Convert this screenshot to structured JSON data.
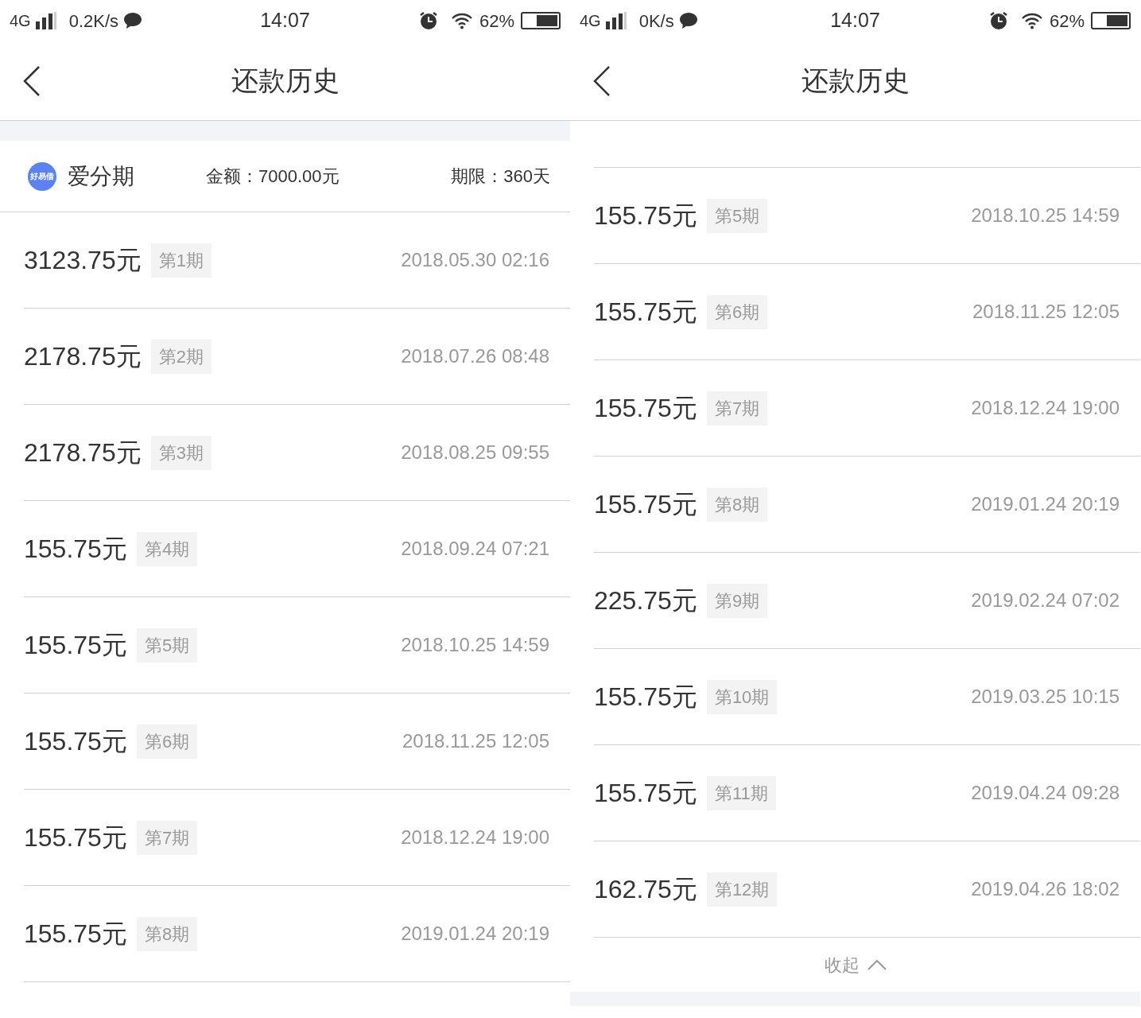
{
  "screens": [
    {
      "status_bar": {
        "network": "4G",
        "speed": "0.2K/s",
        "time": "14:07",
        "battery": "62%"
      },
      "title": "还款历史",
      "summary": {
        "logo_text": "好易借",
        "name": "爱分期",
        "amount": "金额：7000.00元",
        "term": "期限：360天"
      },
      "records": [
        {
          "amount": "3123.75元",
          "period": "第1期",
          "date": "2018.05.30 02:16"
        },
        {
          "amount": "2178.75元",
          "period": "第2期",
          "date": "2018.07.26 08:48"
        },
        {
          "amount": "2178.75元",
          "period": "第3期",
          "date": "2018.08.25 09:55"
        },
        {
          "amount": "155.75元",
          "period": "第4期",
          "date": "2018.09.24 07:21"
        },
        {
          "amount": "155.75元",
          "period": "第5期",
          "date": "2018.10.25 14:59"
        },
        {
          "amount": "155.75元",
          "period": "第6期",
          "date": "2018.11.25 12:05"
        },
        {
          "amount": "155.75元",
          "period": "第7期",
          "date": "2018.12.24 19:00"
        },
        {
          "amount": "155.75元",
          "period": "第8期",
          "date": "2019.01.24 20:19"
        }
      ]
    },
    {
      "status_bar": {
        "network": "4G",
        "speed": "0K/s",
        "time": "14:07",
        "battery": "62%"
      },
      "title": "还款历史",
      "records": [
        {
          "amount": "155.75元",
          "period": "第5期",
          "date": "2018.10.25 14:59"
        },
        {
          "amount": "155.75元",
          "period": "第6期",
          "date": "2018.11.25 12:05"
        },
        {
          "amount": "155.75元",
          "period": "第7期",
          "date": "2018.12.24 19:00"
        },
        {
          "amount": "155.75元",
          "period": "第8期",
          "date": "2019.01.24 20:19"
        },
        {
          "amount": "225.75元",
          "period": "第9期",
          "date": "2019.02.24 07:02"
        },
        {
          "amount": "155.75元",
          "period": "第10期",
          "date": "2019.03.25 10:15"
        },
        {
          "amount": "155.75元",
          "period": "第11期",
          "date": "2019.04.24 09:28"
        },
        {
          "amount": "162.75元",
          "period": "第12期",
          "date": "2019.04.26 18:02"
        }
      ],
      "collapse_label": "收起"
    }
  ]
}
